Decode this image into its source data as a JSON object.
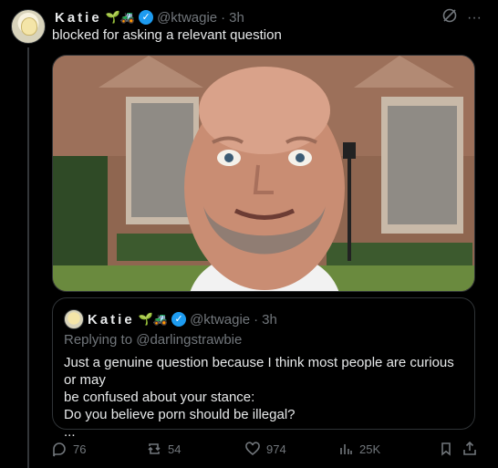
{
  "author": {
    "name": "Katie",
    "emoji": "🌱🚜",
    "handle": "@ktwagie",
    "separator": "·",
    "time": "3h"
  },
  "tweet": {
    "text": "blocked for asking a relevant question"
  },
  "media": {
    "description_icon": "photo-of-bald-man-grinning"
  },
  "quote": {
    "author": {
      "name": "Katie",
      "emoji": "🌱🚜",
      "handle": "@ktwagie",
      "separator": "·",
      "time": "3h"
    },
    "replying_prefix": "Replying to",
    "replying_to": "@darlingstrawbie",
    "lines": [
      "Just a genuine question because I think most people are curious or may",
      "be confused about your stance:",
      "Do you believe porn should be illegal?",
      "..."
    ]
  },
  "actions": {
    "replies": "76",
    "retweets": "54",
    "likes": "974",
    "views": "25K"
  },
  "colors": {
    "background": "#000000",
    "text": "#e7e9ea",
    "muted": "#71767b",
    "verified": "#1d9bf0",
    "border": "#2f3336"
  }
}
